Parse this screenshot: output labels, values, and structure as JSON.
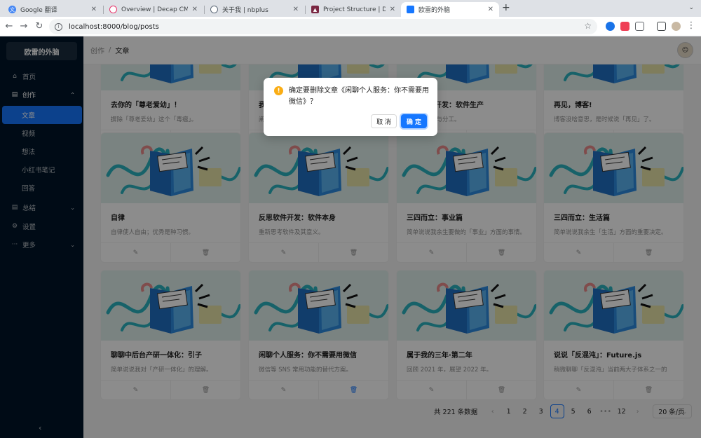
{
  "browser": {
    "tabs": [
      {
        "title": "Google 翻译",
        "icon": "translate-icon",
        "color": "#4285f4"
      },
      {
        "title": "Overview | Decap CMS | Open",
        "icon": "decap-icon",
        "color": "#e8366c"
      },
      {
        "title": "关于我 | nbplus",
        "icon": "nbplus-icon",
        "color": "#5f6b7a"
      },
      {
        "title": "Project Structure | Docs",
        "icon": "docs-icon",
        "color": "#7a2742"
      },
      {
        "title": "欧雷的外脑",
        "icon": "app-icon",
        "color": "#1677ff"
      }
    ],
    "url": "localhost:8000/blog/posts"
  },
  "app": {
    "logo": "欧雷的外脑",
    "menu": {
      "home": "首页",
      "create": "创作",
      "create_sub": [
        "文章",
        "视频",
        "想法",
        "小红书笔记",
        "回答"
      ],
      "summary": "总结",
      "settings": "设置",
      "more": "更多"
    },
    "breadcrumb": [
      "创作",
      "文章"
    ],
    "cards_top": [
      {
        "title": "去你的「尊老爱幼」！",
        "desc": "摒除「尊老爱幼」这个「毒瘤」。"
      },
      {
        "title": "我理解",
        "desc": "阐"
      },
      {
        "title": "后端软件开发：软件生产",
        "desc": "什生产流程与分工。"
      },
      {
        "title": "再见，博客!",
        "desc": "博客没啥意思，是时候说「再见」了。"
      }
    ],
    "cards_mid": [
      {
        "title": "自律",
        "desc": "自律使人自由；优秀是种习惯。"
      },
      {
        "title": "反思软件开发：软件本身",
        "desc": "重新思考软件及其意义。"
      },
      {
        "title": "三四而立：事业篇",
        "desc": "简单说说我余生要做的「事业」方面的事情。"
      },
      {
        "title": "三四而立：生活篇",
        "desc": "简单说说我余生「生活」方面的重要决定。"
      }
    ],
    "cards_bottom": [
      {
        "title": "聊聊中后台产研一体化：引子",
        "desc": "简单说说我对「产研一体化」的理解。"
      },
      {
        "title": "闲聊个人服务：你不需要用微信",
        "desc": "微信等 SNS 常用功能的替代方案。"
      },
      {
        "title": "属于我的三年·第二年",
        "desc": "回顾 2021 年，展望 2022 年。"
      },
      {
        "title": "说说「反混沌」：Future.js",
        "desc": "稍微聊聊「反混沌」当前两大子体系之一的"
      }
    ],
    "pagination": {
      "total": "共 221 条数据",
      "pages": [
        "1",
        "2",
        "3",
        "4",
        "5",
        "6",
        "12"
      ],
      "current": "4",
      "ellipsis": "•••",
      "page_size": "20 条/页"
    }
  },
  "modal": {
    "message": "确定要删除文章《闲聊个人服务：你不需要用微信》？",
    "cancel": "取 消",
    "ok": "确 定"
  },
  "colors": {
    "primary": "#1677ff",
    "sidebar": "#001529",
    "warning": "#faad14"
  }
}
